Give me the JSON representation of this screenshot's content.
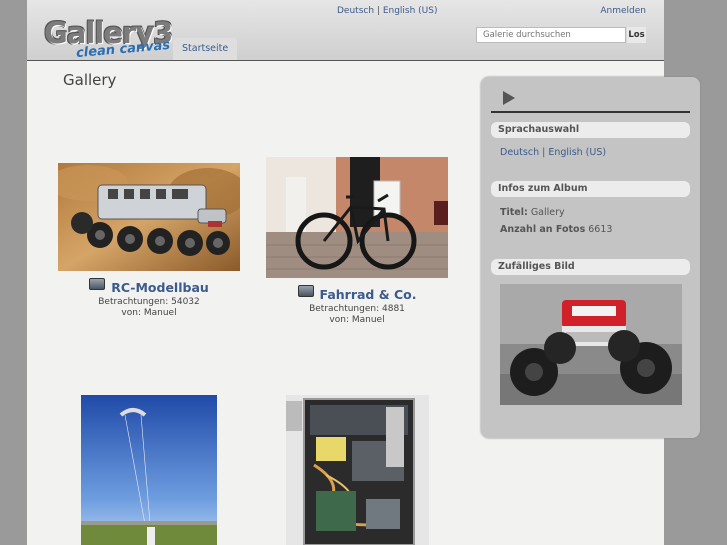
{
  "header": {
    "logo_main": "Gallery3",
    "logo_sub": "clean canvas",
    "lang_deutsch": "Deutsch",
    "lang_sep": " | ",
    "lang_english": "English (US)",
    "login": "Anmelden",
    "nav_home": "Startseite",
    "search_placeholder": "Galerie durchsuchen",
    "search_button": "Los"
  },
  "main": {
    "title": "Gallery",
    "albums": [
      {
        "title": "RC-Modellbau",
        "views": "Betrachtungen: 54032",
        "owner": "von: Manuel"
      },
      {
        "title": "Fahrrad & Co.",
        "views": "Betrachtungen: 4881",
        "owner": "von: Manuel"
      },
      {
        "title": "",
        "views": "",
        "owner": ""
      },
      {
        "title": "",
        "views": "",
        "owner": ""
      }
    ]
  },
  "sidebar": {
    "language_heading": "Sprachauswahl",
    "lang_deutsch": "Deutsch",
    "lang_sep": " | ",
    "lang_english": "English (US)",
    "album_info_heading": "Infos zum Album",
    "title_label": "Titel:",
    "title_value": "Gallery",
    "photos_label": "Anzahl an Fotos",
    "photos_value": "6613",
    "random_heading": "Zufälliges Bild"
  },
  "colors": {
    "link": "#3c5b8c",
    "page_bg": "#f2f2f0",
    "outer_bg": "#9a9a9a",
    "sidebar_bg": "#c4c4c4"
  }
}
